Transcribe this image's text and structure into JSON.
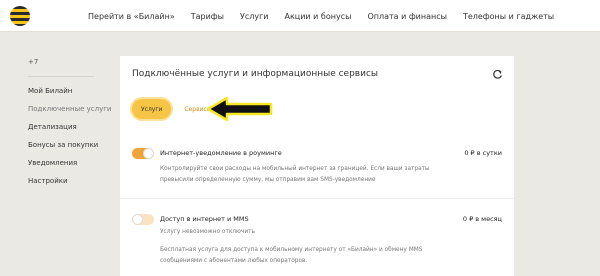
{
  "topnav": {
    "items": [
      "Перейти в «Билайн»",
      "Тарифы",
      "Услуги",
      "Акции и бонусы",
      "Оплата и финансы",
      "Телефоны и гаджеты"
    ]
  },
  "sidebar": {
    "number": "+7",
    "items": [
      "Мой Билайн",
      "Подключенные услуги",
      "Детализация",
      "Бонусы за покупки",
      "Уведомления",
      "Настройки"
    ]
  },
  "card": {
    "title": "Подключённые услуги и информационные сервисы",
    "tabs": [
      "Услуги",
      "Сервисы"
    ],
    "services": [
      {
        "title": "Интернет-уведомление в роуминге",
        "price": "0 ₽ в сутки",
        "enabled": true,
        "description": "Контролируйте свои расходы на мобильный интернет за границей. Если ваши затраты превысили определенную сумму, мы отправим вам SMS-уведомление"
      },
      {
        "title": "Доступ в интернет и MMS",
        "price": "0 ₽ в месяц",
        "enabled": false,
        "status": "Услугу невозможно отключить",
        "description": "Бесплатная услуга для доступа к мобильному интернету от «Билайн» и обмену MMS сообщениями с абонентами любых операторов."
      }
    ]
  },
  "colors": {
    "accent": "#f7c545",
    "toggle_on": "#f1a33a",
    "link": "#d48c1a"
  }
}
